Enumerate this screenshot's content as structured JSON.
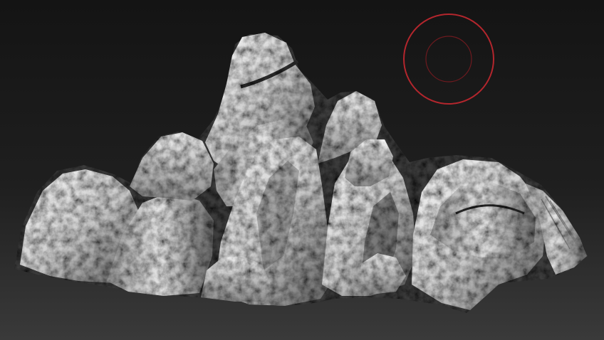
{
  "viewport": {
    "background_top": "#141414",
    "background_bottom": "#3a3a3a"
  },
  "model": {
    "name_icon": "rock-sculpt-mesh",
    "base_color": "#d9d9d9",
    "highlight_color": "#f7f7f7",
    "shadow_color": "#3c3c3c"
  },
  "brush_cursor": {
    "icon": "brush-cursor-icon",
    "outer_ring_color": "#b4262d",
    "inner_ring_color": "#6e1a1f"
  }
}
